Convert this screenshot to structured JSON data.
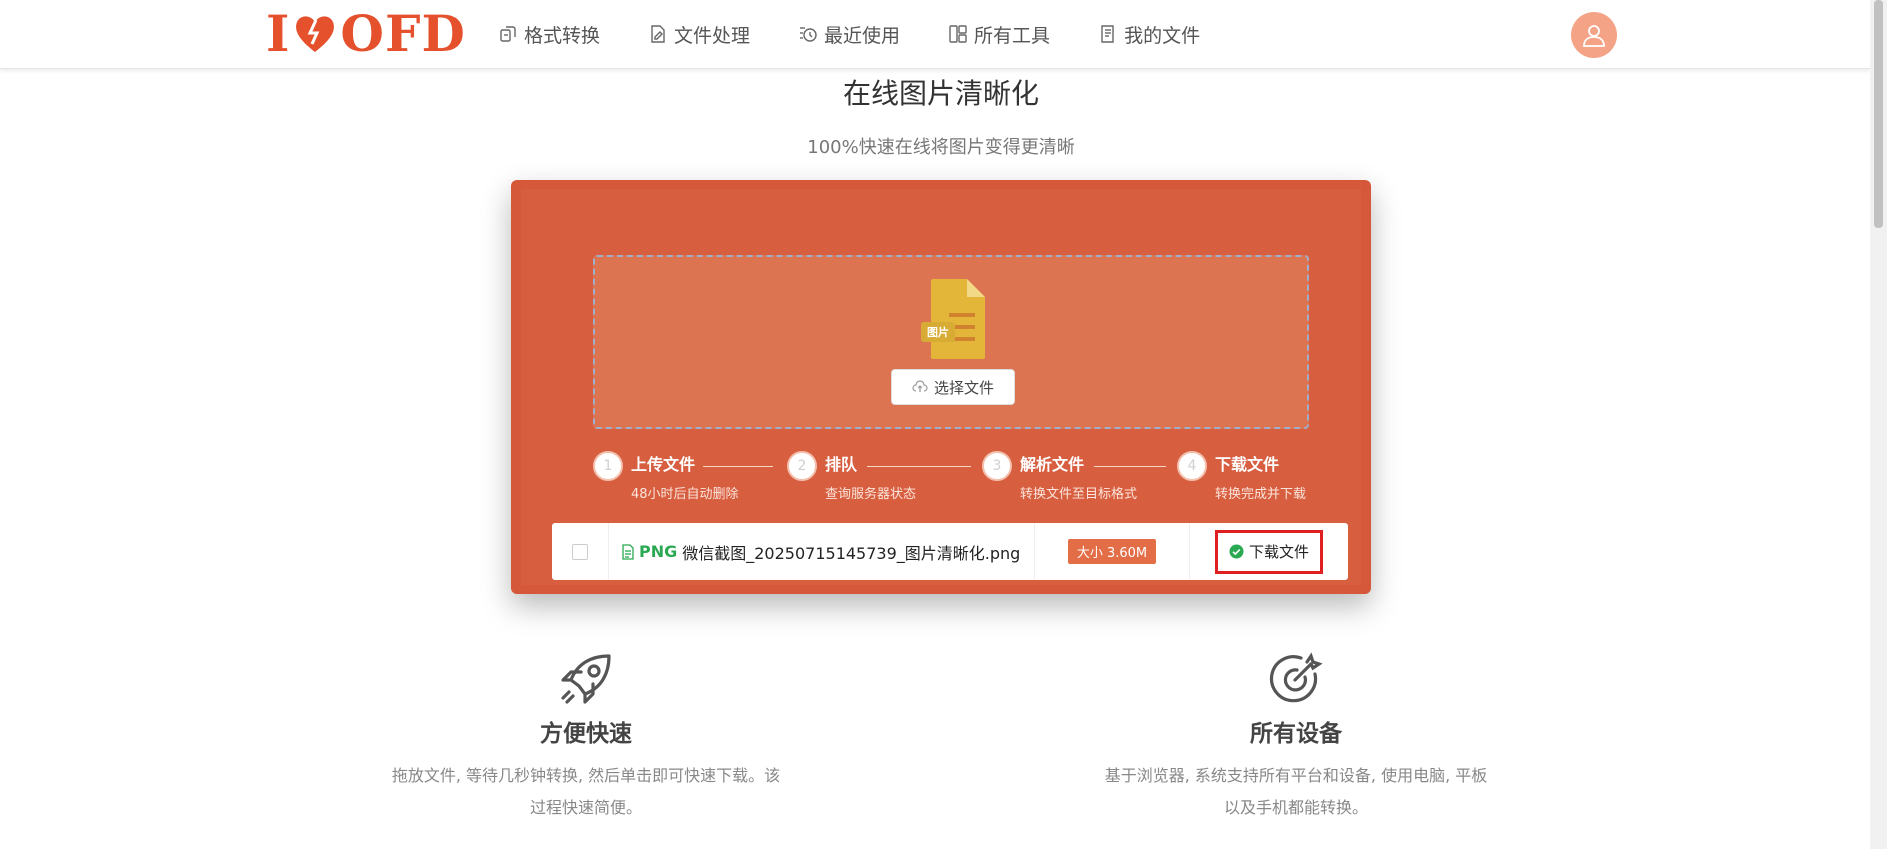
{
  "header": {
    "logo": {
      "left": "I",
      "right": "OFD"
    },
    "nav": [
      {
        "label": "格式转换",
        "icon": "convert-icon"
      },
      {
        "label": "文件处理",
        "icon": "file-edit-icon"
      },
      {
        "label": "最近使用",
        "icon": "recent-icon"
      },
      {
        "label": "所有工具",
        "icon": "grid-icon"
      },
      {
        "label": "我的文件",
        "icon": "my-files-icon"
      }
    ],
    "avatar_icon": "user-icon"
  },
  "page": {
    "title": "在线图片清晰化",
    "subtitle": "100%快速在线将图片变得更清晰"
  },
  "upload": {
    "file_icon_label": "图片",
    "choose_button": "选择文件"
  },
  "steps": [
    {
      "num": "1",
      "title": "上传文件",
      "desc": "48小时后自动删除"
    },
    {
      "num": "2",
      "title": "排队",
      "desc": "查询服务器状态"
    },
    {
      "num": "3",
      "title": "解析文件",
      "desc": "转换文件至目标格式"
    },
    {
      "num": "4",
      "title": "下载文件",
      "desc": "转换完成并下载"
    }
  ],
  "file_row": {
    "ext": "PNG",
    "name": "微信截图_20250715145739_图片清晰化.png",
    "size": "大小 3.60M",
    "download": "下载文件"
  },
  "features": [
    {
      "icon": "rocket-icon",
      "title": "方便快速",
      "desc": "拖放文件, 等待几秒钟转换, 然后单击即可快速下载。该过程快速简便。"
    },
    {
      "icon": "target-icon",
      "title": "所有设备",
      "desc": "基于浏览器, 系统支持所有平台和设备, 使用电脑, 平板以及手机都能转换。"
    }
  ],
  "colors": {
    "accent": "#e5512c",
    "panel": "#d6583a",
    "success": "#2aa952",
    "highlight": "#e02020"
  }
}
